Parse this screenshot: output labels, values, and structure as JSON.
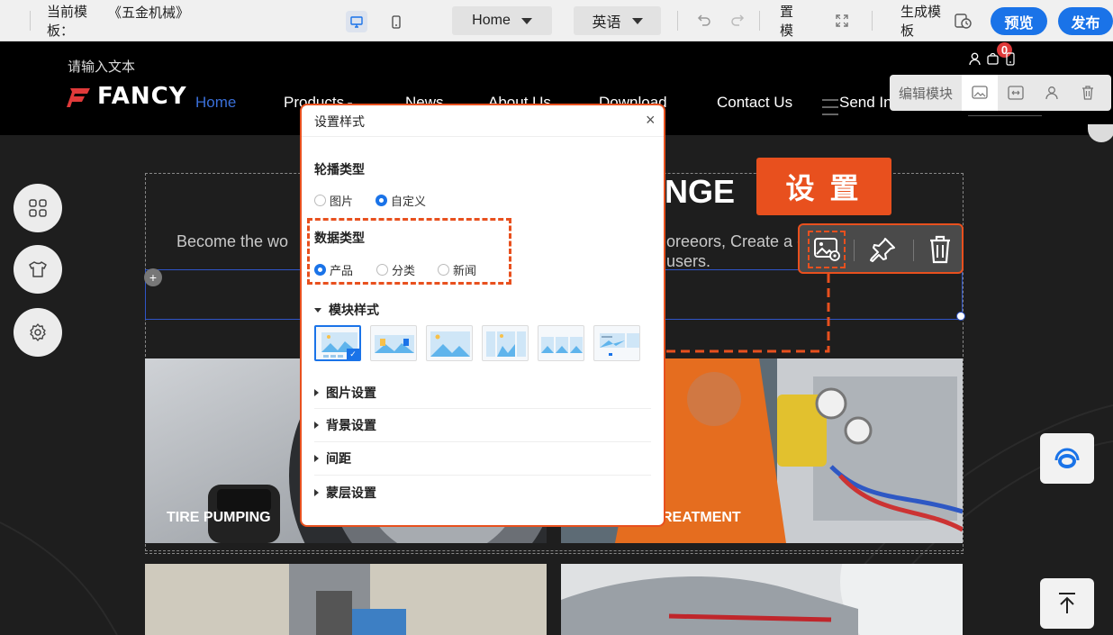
{
  "topbar": {
    "template_label": "当前模\n板：",
    "template_name": "《五金机械》",
    "page_select": "Home",
    "language_select": "英语",
    "settings_label": "置\n模",
    "generate_label": "生成模\n板",
    "preview_label": "预览",
    "publish_label": "发布"
  },
  "site": {
    "header_text": "请输入文本",
    "logo_text": "FANCY",
    "nav": [
      "Home",
      "Products",
      "News",
      "About Us",
      "Download",
      "Contact Us",
      "Send In"
    ],
    "cart_count": "0",
    "section_title_fragment": "NGE",
    "intro_left": "Become the wo",
    "intro_right_1": "oreeors, Create a c",
    "intro_right_2": "users.",
    "card_1_label": "TIRE PUMPING",
    "card_2_label": "REATMENT"
  },
  "edit_bar": {
    "label": "编辑模块"
  },
  "annotation": {
    "callout_label": "设 置"
  },
  "dialog": {
    "title": "设置样式",
    "close_glyph": "×",
    "carousel_type_label": "轮播类型",
    "carousel_options": [
      "图片",
      "自定义"
    ],
    "carousel_selected": "自定义",
    "data_type_label": "数据类型",
    "data_options": [
      "产品",
      "分类",
      "新闻"
    ],
    "data_selected": "产品",
    "module_style_label": "模块样式",
    "accordion": [
      "图片设置",
      "背景设置",
      "间距",
      "蒙层设置"
    ]
  },
  "colors": {
    "accent_blue": "#1a73e8",
    "annotation_orange": "#e8501e",
    "brand_red": "#e03a3a"
  }
}
